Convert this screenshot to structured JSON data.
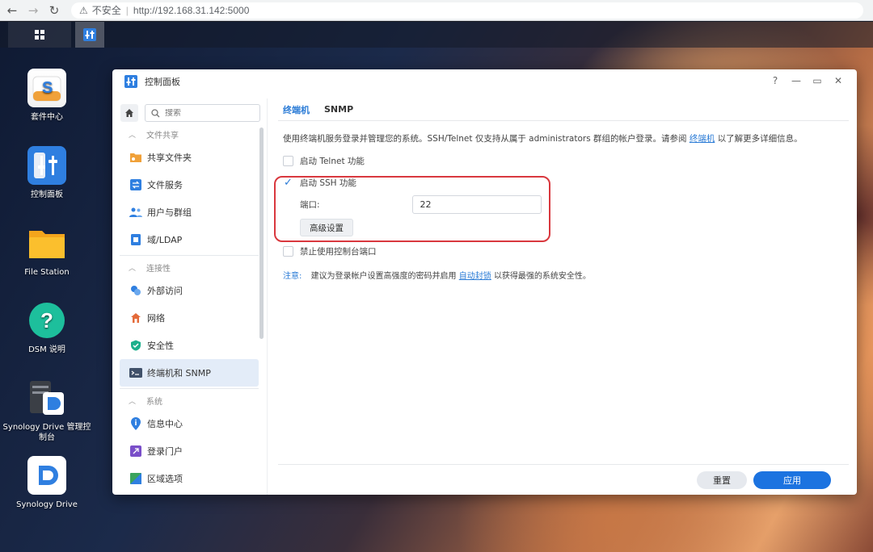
{
  "browser": {
    "insecure_label": "不安全",
    "url": "http://192.168.31.142:5000"
  },
  "desktop": {
    "icons": [
      {
        "label": "套件中心"
      },
      {
        "label": "控制面板"
      },
      {
        "label": "File Station"
      },
      {
        "label": "DSM 说明"
      },
      {
        "label": "Synology Drive 管理控制台"
      },
      {
        "label": "Synology Drive"
      }
    ]
  },
  "window": {
    "title": "控制面板",
    "controls": {
      "help": "?",
      "minimize": "—",
      "maximize": "▭",
      "close": "✕"
    }
  },
  "sidebar": {
    "search_placeholder": "搜索",
    "groups": [
      {
        "label": "文件共享",
        "items": [
          {
            "label": "共享文件夹"
          },
          {
            "label": "文件服务"
          },
          {
            "label": "用户与群组"
          },
          {
            "label": "域/LDAP"
          }
        ]
      },
      {
        "label": "连接性",
        "items": [
          {
            "label": "外部访问"
          },
          {
            "label": "网络"
          },
          {
            "label": "安全性"
          },
          {
            "label": "终端机和 SNMP"
          }
        ]
      },
      {
        "label": "系统",
        "items": [
          {
            "label": "信息中心"
          },
          {
            "label": "登录门户"
          },
          {
            "label": "区域选项"
          }
        ]
      }
    ]
  },
  "content": {
    "tabs": [
      {
        "label": "终端机"
      },
      {
        "label": "SNMP"
      }
    ],
    "desc_before": "使用终端机服务登录并管理您的系统。SSH/Telnet 仅支持从属于 administrators 群组的帐户登录。请参阅",
    "desc_link": "终端机",
    "desc_after": "以了解更多详细信息。",
    "telnet_label": "启动 Telnet 功能",
    "telnet_checked": false,
    "ssh_label": "启动 SSH 功能",
    "ssh_checked": true,
    "port_label": "端口:",
    "port_value": "22",
    "advanced_button": "高级设置",
    "console_label": "禁止使用控制台端口",
    "console_checked": false,
    "note_label": "注意:",
    "note_before": "建议为登录帐户设置高强度的密码并启用",
    "note_link": "自动封锁",
    "note_after": "以获得最强的系统安全性。"
  },
  "footer": {
    "reset_label": "重置",
    "apply_label": "应用"
  },
  "colors": {
    "accent": "#2a7bd6",
    "apply_button": "#1c73e0",
    "highlight": "#d9383e"
  }
}
